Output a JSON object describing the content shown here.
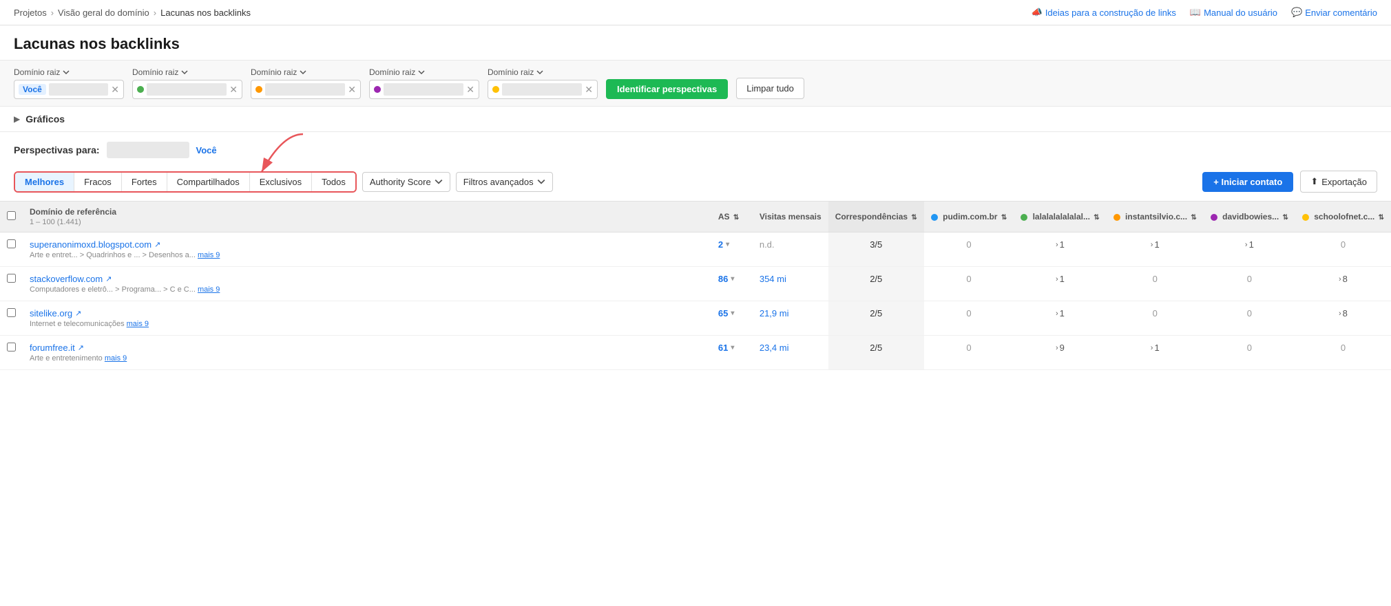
{
  "breadcrumb": {
    "items": [
      "Projetos",
      "Visão geral do domínio",
      "Lacunas nos backlinks"
    ]
  },
  "topActions": {
    "ideias": "Ideias para a construção de links",
    "manual": "Manual do usuário",
    "comentario": "Enviar comentário"
  },
  "pageTitle": "Lacunas nos backlinks",
  "domains": [
    {
      "label": "Domínio raiz",
      "tag": "Você",
      "dotColor": "transparent",
      "hasTag": true
    },
    {
      "label": "Domínio raiz",
      "dotColor": "#4caf50",
      "hasTag": false
    },
    {
      "label": "Domínio raiz",
      "dotColor": "#ff9800",
      "hasTag": false
    },
    {
      "label": "Domínio raiz",
      "dotColor": "#9c27b0",
      "hasTag": false
    },
    {
      "label": "Domínio raiz",
      "dotColor": "#ffc107",
      "hasTag": false
    }
  ],
  "buttons": {
    "identify": "Identificar perspectivas",
    "clearAll": "Limpar tudo",
    "iniciarContato": "+ Iniciar contato",
    "exportacao": "Exportação"
  },
  "graficos": {
    "label": "Gráficos"
  },
  "perspectivas": {
    "label": "Perspectivas para:",
    "youLabel": "Você"
  },
  "tabs": [
    {
      "id": "melhores",
      "label": "Melhores",
      "active": true
    },
    {
      "id": "fracos",
      "label": "Fracos",
      "active": false
    },
    {
      "id": "fortes",
      "label": "Fortes",
      "active": false
    },
    {
      "id": "compartilhados",
      "label": "Compartilhados",
      "active": false
    },
    {
      "id": "exclusivos",
      "label": "Exclusivos",
      "active": false
    },
    {
      "id": "todos",
      "label": "Todos",
      "active": false
    }
  ],
  "filters": {
    "authorityScore": "Authority Score",
    "filtrosAvancados": "Filtros avançados"
  },
  "table": {
    "headers": {
      "checkbox": "",
      "domainRef": "Domínio de referência",
      "rowRange": "1 – 100 (1.441)",
      "as": "AS",
      "visitasMensais": "Visitas mensais",
      "correspondencias": "Correspondências",
      "pudim": "pudim.com.br",
      "lalalala": "lalalalalalalal...",
      "instantsilvio": "instantsilvio.c...",
      "davidbowies": "davidbowies...",
      "schoolofnet": "schoolofnet.c..."
    },
    "dotColors": {
      "pudim": "#2196f3",
      "lalalala": "#4caf50",
      "instantsilvio": "#ff9800",
      "davidbowies": "#9c27b0",
      "schoolofnet": "#ffc107"
    },
    "rows": [
      {
        "domain": "superanonimoxd.blogspot.com",
        "externalLink": true,
        "category": "Arte e entret... > Quadrinhos e ... > Desenhos a...",
        "mais": "mais 9",
        "as": "2",
        "visits": "n.d.",
        "visitsIsND": true,
        "correspondencias": "3/5",
        "pudim": "0",
        "lalalala": "> 1",
        "instantsilvio": "> 1",
        "davidbowies": "> 1",
        "schoolofnet": "0"
      },
      {
        "domain": "stackoverflow.com",
        "externalLink": true,
        "category": "Computadores e eletrô... > Programa... > C e C...",
        "mais": "mais 9",
        "as": "86",
        "visits": "354 mi",
        "visitsIsND": false,
        "correspondencias": "2/5",
        "pudim": "0",
        "lalalala": "> 1",
        "instantsilvio": "0",
        "davidbowies": "0",
        "schoolofnet": "> 8"
      },
      {
        "domain": "sitelike.org",
        "externalLink": true,
        "category": "Internet e telecomunicações",
        "mais": "mais 9",
        "as": "65",
        "visits": "21,9 mi",
        "visitsIsND": false,
        "correspondencias": "2/5",
        "pudim": "0",
        "lalalala": "> 1",
        "instantsilvio": "0",
        "davidbowies": "0",
        "schoolofnet": "> 8"
      },
      {
        "domain": "forumfree.it",
        "externalLink": true,
        "category": "Arte e entretenimento",
        "mais": "mais 9",
        "as": "61",
        "visits": "23,4 mi",
        "visitsIsND": false,
        "correspondencias": "2/5",
        "pudim": "0",
        "lalalala": "> 9",
        "instantsilvio": "> 1",
        "davidbowies": "0",
        "schoolofnet": "0"
      }
    ]
  }
}
